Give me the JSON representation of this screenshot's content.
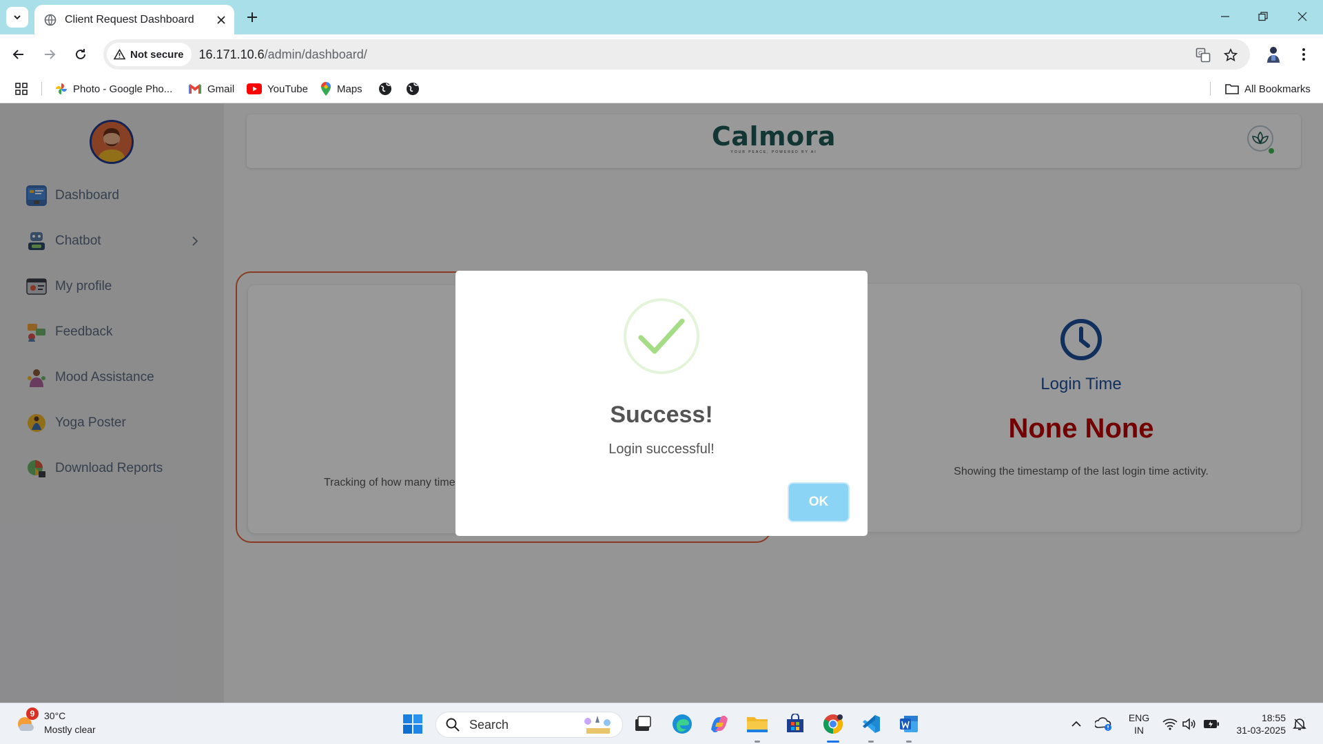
{
  "browser": {
    "tab_title": "Client Request Dashboard",
    "security_label": "Not secure",
    "url_host": "16.171.10.6",
    "url_path": "/admin/dashboard/",
    "bookmarks": [
      "Photo - Google Pho...",
      "Gmail",
      "YouTube",
      "Maps"
    ],
    "all_bookmarks": "All Bookmarks"
  },
  "sidebar": {
    "items": [
      {
        "label": "Dashboard",
        "icon": "dashboard-icon"
      },
      {
        "label": "Chatbot",
        "icon": "chatbot-icon"
      },
      {
        "label": "My profile",
        "icon": "profile-icon"
      },
      {
        "label": "Feedback",
        "icon": "feedback-icon"
      },
      {
        "label": "Mood Assistance",
        "icon": "mood-icon"
      },
      {
        "label": "Yoga Poster",
        "icon": "yoga-icon"
      },
      {
        "label": "Download Reports",
        "icon": "reports-icon"
      }
    ]
  },
  "header": {
    "logo": "Calmora",
    "tagline": "YOUR PEACE, POWERED BY AI"
  },
  "cards": {
    "visits": {
      "description": "Tracking of how many time"
    },
    "login": {
      "title": "Login Time",
      "value": "None None",
      "description": "Showing the timestamp of the last login time activity."
    }
  },
  "modal": {
    "title": "Success!",
    "message": "Login successful!",
    "ok_label": "OK"
  },
  "taskbar": {
    "weather_badge": "9",
    "temperature": "30°C",
    "condition": "Mostly clear",
    "search_label": "Search",
    "lang_line1": "ENG",
    "lang_line2": "IN",
    "time": "18:55",
    "date": "31-03-2025"
  },
  "colors": {
    "accent_logo": "#1f5b57",
    "login_title": "#1d4f9c",
    "login_value": "#c00000",
    "card_outline": "#e3633a",
    "success_green": "#a5dc86",
    "ok_button": "#8cd4f5"
  }
}
